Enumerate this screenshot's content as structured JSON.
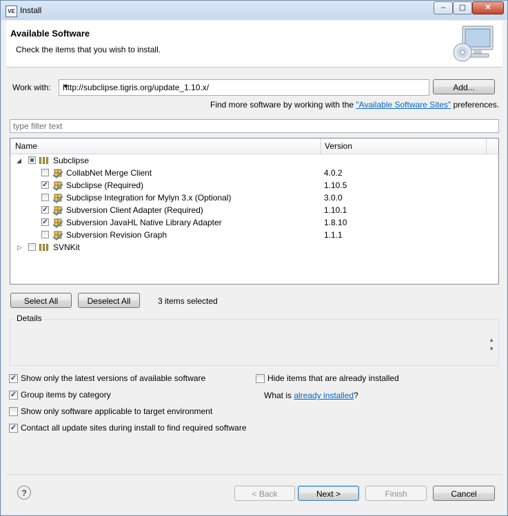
{
  "window": {
    "title": "Install",
    "app_icon_text": "VE",
    "controls": {
      "minimize": "‒",
      "maximize": "▢",
      "close": "✕"
    }
  },
  "header": {
    "title": "Available Software",
    "subtitle": "Check the items that you wish to install."
  },
  "work_with": {
    "label": "Work with:",
    "value": "http://subclipse.tigris.org/update_1.10.x/",
    "add_label": "Add...",
    "more_prefix": "Find more software by working with the ",
    "more_link": "\"Available Software Sites\"",
    "more_suffix": " preferences."
  },
  "filter": {
    "placeholder": "type filter text"
  },
  "tree": {
    "columns": [
      "Name",
      "Version"
    ],
    "categories": [
      {
        "name": "Subclipse",
        "expanded": true,
        "check_state": "partial",
        "items": [
          {
            "name": "CollabNet Merge Client",
            "version": "4.0.2",
            "checked": false
          },
          {
            "name": "Subclipse (Required)",
            "version": "1.10.5",
            "checked": true
          },
          {
            "name": "Subclipse Integration for Mylyn 3.x (Optional)",
            "version": "3.0.0",
            "checked": false
          },
          {
            "name": "Subversion Client Adapter (Required)",
            "version": "1.10.1",
            "checked": true
          },
          {
            "name": "Subversion JavaHL Native Library Adapter",
            "version": "1.8.10",
            "checked": true
          },
          {
            "name": "Subversion Revision Graph",
            "version": "1.1.1",
            "checked": false
          }
        ]
      },
      {
        "name": "SVNKit",
        "expanded": false,
        "check_state": "unchecked",
        "items": []
      }
    ]
  },
  "selection": {
    "select_all": "Select All",
    "deselect_all": "Deselect All",
    "count_text": "3 items selected"
  },
  "details": {
    "label": "Details"
  },
  "options": {
    "latest_versions": {
      "label": "Show only the latest versions of available software",
      "checked": true
    },
    "group_by_category": {
      "label": "Group items by category",
      "checked": true
    },
    "applicable_only": {
      "label": "Show only software applicable to target environment",
      "checked": false
    },
    "contact_all_sites": {
      "label": "Contact all update sites during install to find required software",
      "checked": true
    },
    "hide_installed": {
      "label": "Hide items that are already installed",
      "checked": false
    },
    "what_is_prefix": "What is ",
    "what_is_link": "already installed",
    "what_is_suffix": "?"
  },
  "footer": {
    "help": "?",
    "back": "< Back",
    "next": "Next >",
    "finish": "Finish",
    "cancel": "Cancel"
  }
}
